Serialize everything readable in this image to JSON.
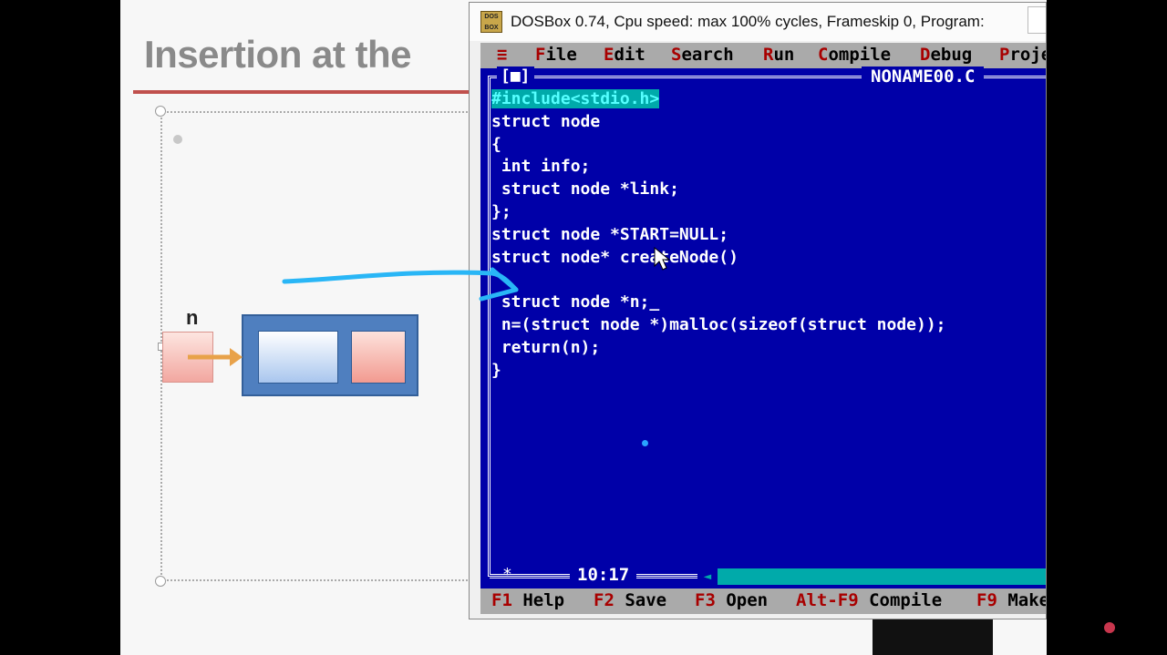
{
  "slide": {
    "title": "Insertion at the",
    "node_label": "n"
  },
  "window": {
    "title": "DOSBox 0.74, Cpu speed: max 100% cycles, Frameskip  0, Program:",
    "icon_text": "DOS BOX"
  },
  "menu": {
    "system": "≡",
    "items": [
      {
        "hotkey": "F",
        "rest": "ile"
      },
      {
        "hotkey": "E",
        "rest": "dit"
      },
      {
        "hotkey": "S",
        "rest": "earch"
      },
      {
        "hotkey": "R",
        "rest": "un"
      },
      {
        "hotkey": "C",
        "rest": "ompile"
      },
      {
        "hotkey": "D",
        "rest": "ebug"
      },
      {
        "hotkey": "P",
        "rest": "roje"
      }
    ]
  },
  "editor": {
    "close_box": "[■]",
    "filename": "NONAME00.C",
    "code_lines": [
      "#include<stdio.h>",
      "struct node",
      "{",
      " int info;",
      " struct node *link;",
      "};",
      "struct node *START=NULL;",
      "struct node* createNode()",
      "",
      " struct node *n;_",
      " n=(struct node *)malloc(sizeof(struct node));",
      " return(n);",
      "}"
    ],
    "cursor_position": "10:17",
    "status_marker": "*"
  },
  "function_keys": [
    {
      "key": "F1",
      "label": "Help"
    },
    {
      "key": "F2",
      "label": "Save"
    },
    {
      "key": "F3",
      "label": "Open"
    },
    {
      "key": "Alt-F9",
      "label": "Compile"
    },
    {
      "key": "F9",
      "label": "Make"
    }
  ],
  "colors": {
    "dos_blue": "#0000a8",
    "menu_gray": "#aaaaaa",
    "hotkey_red": "#a80000",
    "annotation_arrow": "#29b6f6",
    "title_rule": "#c0504d"
  }
}
